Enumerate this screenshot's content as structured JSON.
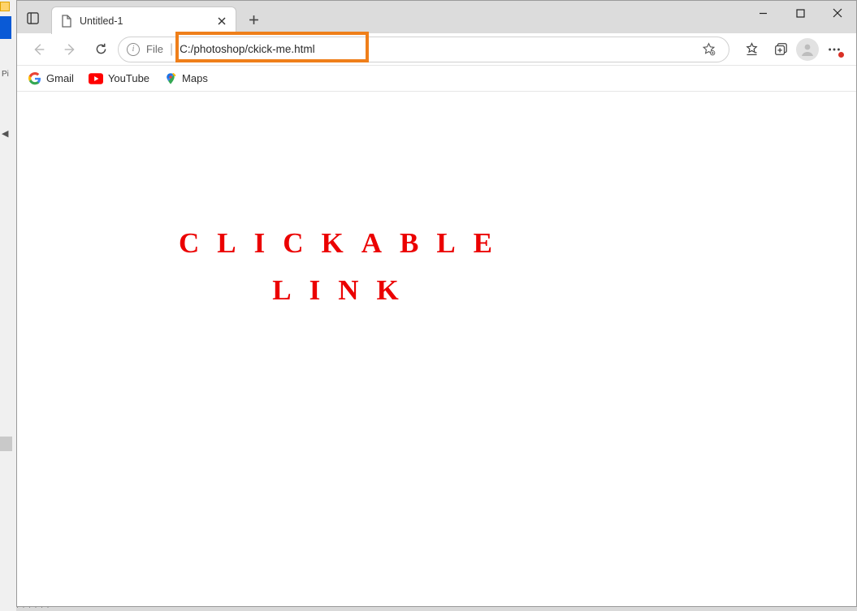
{
  "desktop": {
    "pi_label": "Pi"
  },
  "window_controls": {
    "minimize_title": "Minimize",
    "maximize_title": "Maximize",
    "close_title": "Close"
  },
  "tabstrip": {
    "tab_actions_title": "Tab actions",
    "tabs": [
      {
        "title": "Untitled-1"
      }
    ],
    "new_tab_title": "New tab"
  },
  "toolbar": {
    "back_title": "Back",
    "forward_title": "Forward",
    "reload_title": "Refresh",
    "address": {
      "scheme_label": "File",
      "url": "C:/photoshop/ckick-me.html",
      "site_info_title": "View site information",
      "favorite_title": "Add this page to favorites"
    },
    "favorites_title": "Favorites",
    "collections_title": "Collections",
    "profile_title": "Profile",
    "more_title": "Settings and more"
  },
  "bookmarks": [
    {
      "label": "Gmail",
      "icon": "google"
    },
    {
      "label": "YouTube",
      "icon": "youtube"
    },
    {
      "label": "Maps",
      "icon": "maps"
    }
  ],
  "page": {
    "heading": "CLICKABLE\nLINK"
  },
  "annotation": {
    "highlight_target": "address-bar-url"
  }
}
